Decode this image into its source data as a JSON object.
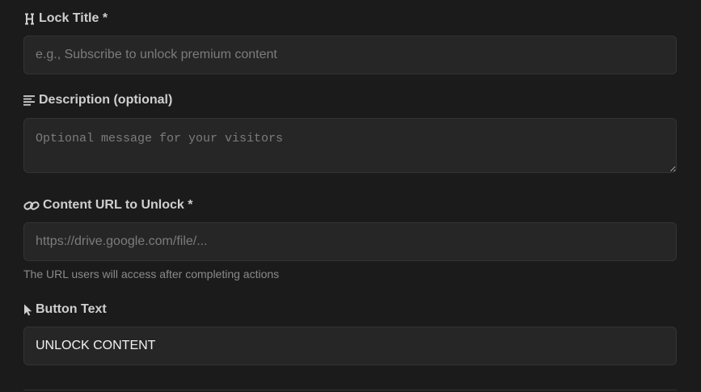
{
  "form": {
    "lock_title": {
      "label": "Lock Title *",
      "placeholder": "e.g., Subscribe to unlock premium content",
      "value": "",
      "icon": "heading-icon"
    },
    "description": {
      "label": "Description (optional)",
      "placeholder": "Optional message for your visitors",
      "value": "",
      "icon": "align-left-icon"
    },
    "content_url": {
      "label": "Content URL to Unlock *",
      "placeholder": "https://drive.google.com/file/...",
      "value": "",
      "help": "The URL users will access after completing actions",
      "icon": "link-icon"
    },
    "button_text": {
      "label": "Button Text",
      "value": "UNLOCK CONTENT",
      "icon": "cursor-icon"
    }
  }
}
